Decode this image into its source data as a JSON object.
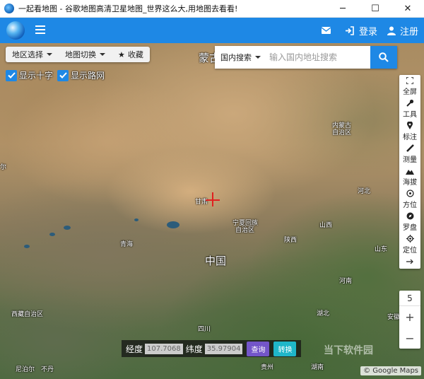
{
  "window": {
    "title": "一起看地图 - 谷歌地图高清卫星地图_世界这么大,用地图去看看!",
    "minimize": "─",
    "maximize": "☐",
    "close": "✕"
  },
  "nav": {
    "login_label": "登录",
    "register_label": "注册",
    "icons": [
      "mail-icon",
      "login-icon",
      "user-icon"
    ]
  },
  "toolbar": {
    "region_select": "地区选择",
    "map_switch": "地图切换",
    "favorite": "收藏"
  },
  "checks": {
    "crosshair_label": "显示十字",
    "roadnet_label": "显示路网"
  },
  "search": {
    "scope": "国内搜索",
    "placeholder": "输入国内地址搜索"
  },
  "right_tools": [
    {
      "label": "全屏",
      "icon": "fullscreen-icon"
    },
    {
      "label": "工具",
      "icon": "wrench-icon"
    },
    {
      "label": "标注",
      "icon": "pin-icon"
    },
    {
      "label": "测量",
      "icon": "ruler-icon"
    },
    {
      "label": "海拔",
      "icon": "mountain-icon"
    },
    {
      "label": "方位",
      "icon": "target-icon"
    },
    {
      "label": "罗盘",
      "icon": "compass-icon"
    },
    {
      "label": "定位",
      "icon": "locate-icon"
    }
  ],
  "zoom": {
    "level": "5",
    "plus": "+",
    "minus": "−"
  },
  "coords": {
    "lng_label": "经度",
    "lng_value": "107.7068",
    "lat_label": "纬度",
    "lat_value": "35.97904",
    "query_label": "查询",
    "convert_label": "转换"
  },
  "map_labels": {
    "mongolia": "蒙古",
    "inner_mongolia_1": "内蒙古",
    "inner_mongolia_2": "自治区",
    "gansu": "甘肃",
    "ningxia_1": "宁夏回族",
    "ningxia_2": "自治区",
    "qinghai": "青海",
    "china": "中国",
    "shaanxi": "陕西",
    "shanxi": "山西",
    "hebei": "河北",
    "shandong": "山东",
    "henan": "河南",
    "hubei": "湖北",
    "anhui": "安徽",
    "sichuan": "四川",
    "tibet": "西藏自治区",
    "guizhou": "贵州",
    "hunan": "湖南",
    "nepal": "尼泊尔",
    "buxi": "不丹",
    "edge_left": "尔"
  },
  "attribution": "© Google Maps",
  "watermark": "当下软件园"
}
